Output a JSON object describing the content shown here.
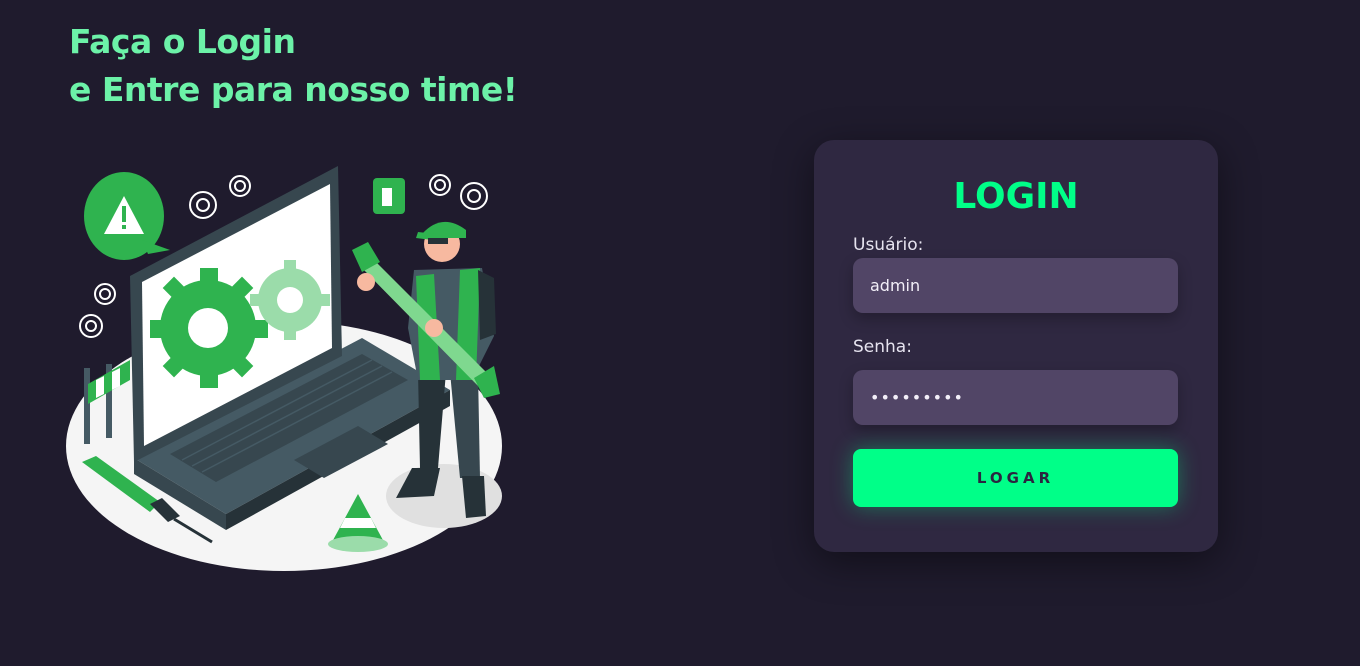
{
  "hero": {
    "line1": "Faça o Login",
    "line2": "e Entre para nosso time!"
  },
  "illustration": {
    "icon": "technician-fixing-laptop-illustration"
  },
  "login": {
    "title": "LOGIN",
    "username_label": "Usuário:",
    "username_value": "admin",
    "password_label": "Senha:",
    "password_value": "•••••••••",
    "submit_label": "LOGAR"
  },
  "colors": {
    "background": "#1f1b2d",
    "card": "#2f2841",
    "accent": "#00ff88",
    "headline": "#6cf2a8",
    "input": "#514566"
  }
}
